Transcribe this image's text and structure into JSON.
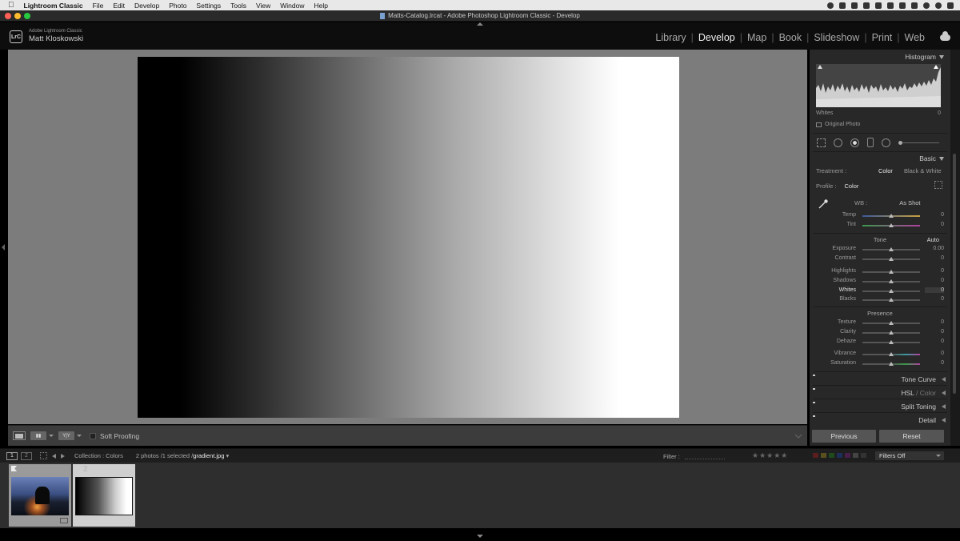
{
  "menubar": {
    "app_name": "Lightroom Classic",
    "items": [
      "File",
      "Edit",
      "Develop",
      "Photo",
      "Settings",
      "Tools",
      "View",
      "Window",
      "Help"
    ]
  },
  "window": {
    "title": "Matts-Catalog.lrcat - Adobe Photoshop Lightroom Classic - Develop"
  },
  "identity": {
    "badge": "LrC",
    "line1": "Adobe Lightroom Classic",
    "line2": "Matt Kloskowski"
  },
  "modules": [
    "Library",
    "Develop",
    "Map",
    "Book",
    "Slideshow",
    "Print",
    "Web"
  ],
  "active_module": "Develop",
  "toolbar": {
    "soft_proofing": "Soft Proofing"
  },
  "histogram": {
    "title": "Histogram",
    "readout_label": "Whites",
    "readout_value": "0",
    "original_photo": "Original Photo"
  },
  "basic": {
    "title": "Basic",
    "treatment_label": "Treatment :",
    "treatment_color": "Color",
    "treatment_bw": "Black & White",
    "profile_label": "Profile :",
    "profile_value": "Color",
    "wb_label": "WB :",
    "wb_value": "As Shot",
    "tone_title": "Tone",
    "auto": "Auto",
    "presence_title": "Presence",
    "sliders": {
      "temp": {
        "label": "Temp",
        "value": "0",
        "pos": 0.5
      },
      "tint": {
        "label": "Tint",
        "value": "0",
        "pos": 0.5
      },
      "exposure": {
        "label": "Exposure",
        "value": "0.00",
        "pos": 0.5
      },
      "contrast": {
        "label": "Contrast",
        "value": "0",
        "pos": 0.5
      },
      "highlights": {
        "label": "Highlights",
        "value": "0",
        "pos": 0.5
      },
      "shadows": {
        "label": "Shadows",
        "value": "0",
        "pos": 0.5
      },
      "whites": {
        "label": "Whites",
        "value": "0",
        "pos": 0.5
      },
      "blacks": {
        "label": "Blacks",
        "value": "0",
        "pos": 0.5
      },
      "texture": {
        "label": "Texture",
        "value": "0",
        "pos": 0.5
      },
      "clarity": {
        "label": "Clarity",
        "value": "0",
        "pos": 0.5
      },
      "dehaze": {
        "label": "Dehaze",
        "value": "0",
        "pos": 0.5
      },
      "vibrance": {
        "label": "Vibrance",
        "value": "0",
        "pos": 0.5
      },
      "saturation": {
        "label": "Saturation",
        "value": "0",
        "pos": 0.5
      }
    }
  },
  "panels": {
    "tone_curve": "Tone Curve",
    "hsl": "HSL",
    "hsl_sep": "/",
    "color": "Color",
    "split_toning": "Split Toning",
    "detail": "Detail"
  },
  "buttons": {
    "previous": "Previous",
    "reset": "Reset"
  },
  "filmstrip": {
    "page1": "1",
    "page2": "2",
    "collection": "Collection : Colors",
    "count": "2 photos /1 selected /",
    "filename": "gradient.jpg",
    "filter_label": "Filter :",
    "filter_value": "Filters Off",
    "thumb2_index": "2",
    "stars": "★★★★★"
  }
}
